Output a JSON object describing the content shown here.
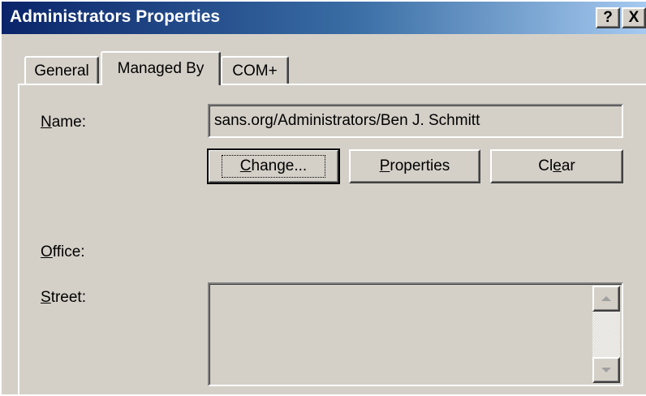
{
  "window": {
    "title": "Administrators Properties",
    "help_label": "?",
    "close_label": "X"
  },
  "tabs": [
    {
      "label": "General",
      "selected": false
    },
    {
      "label": "Managed By",
      "selected": true
    },
    {
      "label": "COM+",
      "selected": false
    }
  ],
  "form": {
    "name_label_prefix": "",
    "name_label_mnemonic": "N",
    "name_label_rest": "ame:",
    "name_value": "sans.org/Administrators/Ben J. Schmitt",
    "office_label_mnemonic": "O",
    "office_label_rest": "ffice:",
    "street_label_mnemonic": "S",
    "street_label_rest": "treet:",
    "street_value": ""
  },
  "buttons": {
    "change_mnemonic": "C",
    "change_rest": "hange...",
    "properties_mnemonic": "P",
    "properties_rest": "roperties",
    "clear_prefix": "Cl",
    "clear_mnemonic": "e",
    "clear_rest": "ar"
  },
  "icons": [
    "help-icon",
    "close-icon",
    "scroll-up-icon",
    "scroll-down-icon"
  ]
}
